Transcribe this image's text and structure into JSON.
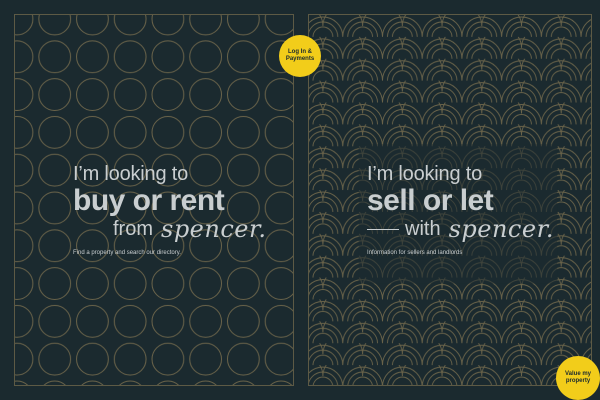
{
  "left_panel": {
    "line1": "I’m looking to",
    "line2": "buy or rent",
    "line3": "from",
    "brand": "spencer.",
    "description": "Find a property and search our directory."
  },
  "right_panel": {
    "line1": "I’m looking to",
    "line2": "sell or let",
    "line3": "with",
    "brand": "spencer.",
    "description": "Information for sellers and landlords"
  },
  "badges": {
    "login": "Log In & Payments",
    "value": "Value my property"
  },
  "colors": {
    "background": "#1b2a2f",
    "pattern": "#6b644a",
    "text": "#c9ced0",
    "accent": "#f2cd1a"
  }
}
